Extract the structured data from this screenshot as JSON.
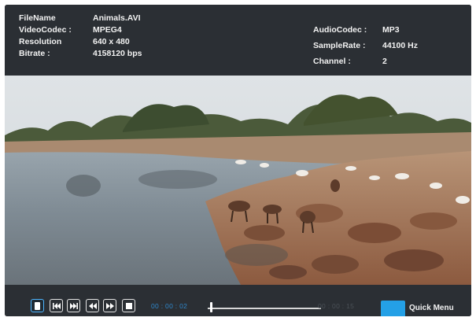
{
  "info": {
    "file_name_label": "FileName",
    "file_name_value": "Animals.AVI",
    "video_codec_label": "VideoCodec :",
    "video_codec_value": "MPEG4",
    "resolution_label": "Resolution",
    "resolution_value": "640 x 480",
    "bitrate_label": "Bitrate :",
    "bitrate_value": "4158120 bps",
    "audio_codec_label": "AudioCodec :",
    "audio_codec_value": "MP3",
    "sample_rate_label": "SampleRate :",
    "sample_rate_value": "44100 Hz",
    "channel_label": "Channel :",
    "channel_value": "2"
  },
  "controls": {
    "buttons": [
      {
        "name": "pause-icon",
        "active": true
      },
      {
        "name": "skip-previous-icon",
        "active": false
      },
      {
        "name": "skip-next-icon",
        "active": false
      },
      {
        "name": "rewind-icon",
        "active": false
      },
      {
        "name": "fast-forward-icon",
        "active": false
      },
      {
        "name": "stop-icon",
        "active": false
      }
    ],
    "current_time": "00 : 00 : 02",
    "total_time": "00 : 00 : 15",
    "progress_fraction": 0.02,
    "quick_menu_label": "Quick Menu"
  },
  "colors": {
    "accent": "#24a0e6",
    "time_current": "#2f86c9",
    "panel": "#2b2f34"
  }
}
